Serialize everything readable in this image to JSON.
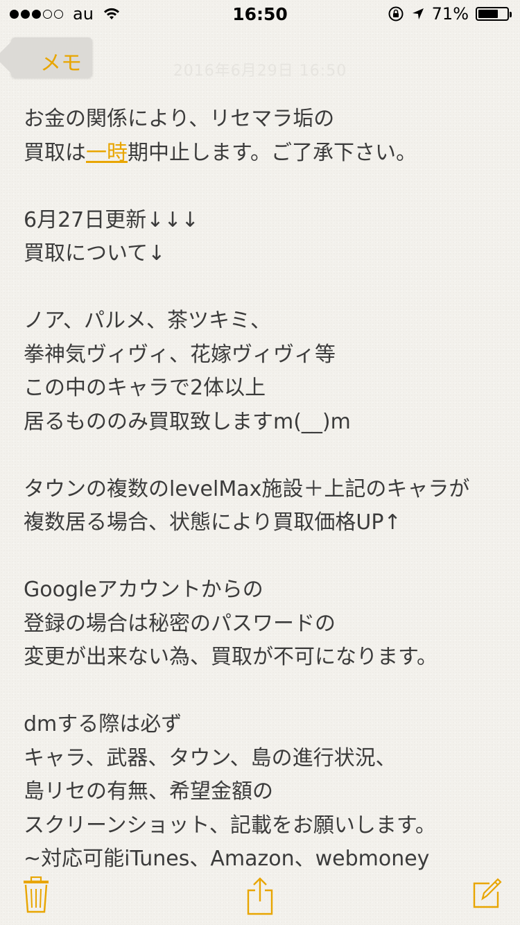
{
  "status_bar": {
    "carrier": "au",
    "time": "16:50",
    "battery": "71%",
    "battery_level": 0.71,
    "signal_filled": 3,
    "signal_total": 5
  },
  "nav": {
    "back_label": "メモ",
    "date": "2016年6月29日 16:50"
  },
  "note": {
    "lines": [
      {
        "text": "お金の関係により、リセマラ垢の"
      },
      {
        "pre": "買取は",
        "highlight": "一時",
        "post": "期中止します。ご了承下さい。"
      },
      {
        "text": ""
      },
      {
        "text": "6月27日更新↓↓↓"
      },
      {
        "text": "買取について↓"
      },
      {
        "text": ""
      },
      {
        "text": "ノア、パルメ、茶ツキミ、"
      },
      {
        "text": "拳神気ヴィヴィ、花嫁ヴィヴィ等"
      },
      {
        "text": "この中のキャラで2体以上"
      },
      {
        "text": "居るもののみ買取致しますm(__)m"
      },
      {
        "text": ""
      },
      {
        "text": "タウンの複数のlevelMax施設＋上記のキャラが"
      },
      {
        "text": "複数居る場合、状態により買取価格UP↑"
      },
      {
        "text": ""
      },
      {
        "text": "Googleアカウントからの"
      },
      {
        "text": "登録の場合は秘密のパスワードの"
      },
      {
        "text": "変更が出来ない為、買取が不可になります。"
      },
      {
        "text": ""
      },
      {
        "text": "dmする際は必ず"
      },
      {
        "text": "キャラ、武器、タウン、島の進行状況、"
      },
      {
        "text": "島リセの有無、希望金額の"
      },
      {
        "text": "スクリーンショット、記載をお願いします。"
      },
      {
        "text": "~対応可能iTunes、Amazon、webmoney"
      }
    ]
  },
  "toolbar": {
    "trash_icon": "trash-icon",
    "share_icon": "share-icon",
    "compose_icon": "compose-icon"
  },
  "colors": {
    "accent": "#e8a500",
    "text": "#3b3b3b",
    "paper": "#f3f1ec"
  }
}
